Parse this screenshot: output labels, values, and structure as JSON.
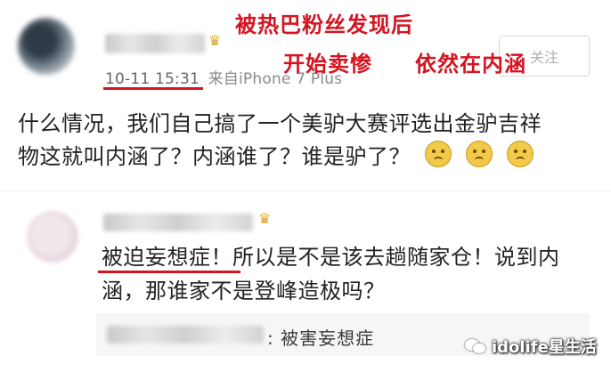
{
  "annotation": {
    "line1": "被热巴粉丝发现后",
    "line2a": "开始卖惨",
    "line2b": "依然在内涵"
  },
  "post": {
    "timestamp": "10-11 15:31",
    "source": "来自iPhone 7 Plus",
    "follow_label": "关注",
    "text_line1": "什么情况，我们自己搞了一个美驴大赛评选出金驴吉祥",
    "text_line2": "物这就叫内涵了？内涵谁了？谁是驴了？"
  },
  "reply": {
    "highlight": "被迫妄想症！",
    "text_line1_rest": "所以是不是该去趟随家仓！说到内",
    "text_line2": "涵，那谁家不是登峰造极吗？"
  },
  "sub_reply": {
    "separator": ":",
    "text": "被害妄想症"
  },
  "watermark": {
    "text": "idolife星生活"
  },
  "colors": {
    "annotation_red": "#d51421",
    "emoji_yellow": "#f3c94a"
  }
}
